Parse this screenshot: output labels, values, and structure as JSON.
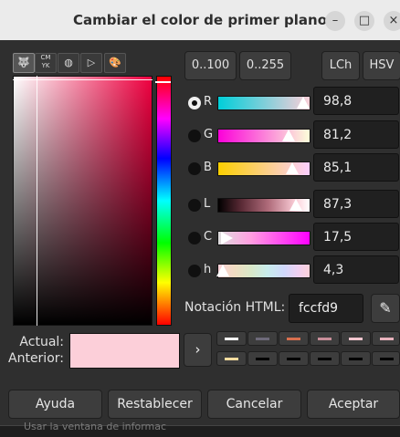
{
  "window": {
    "title": "Cambiar el color de primer plano"
  },
  "window_controls": {
    "minimize": "–",
    "maximize": "□",
    "close": "×"
  },
  "notebook_tabs": [
    {
      "icon": "gimp-wilber-icon",
      "glyph": "🐺",
      "active": true
    },
    {
      "icon": "cmyk-icon",
      "glyph": "CMYK",
      "active": false
    },
    {
      "icon": "water-color-icon",
      "glyph": "◍",
      "active": false
    },
    {
      "icon": "color-wheel-icon",
      "glyph": "▷",
      "active": false
    },
    {
      "icon": "palette-icon",
      "glyph": "🎨",
      "active": false
    }
  ],
  "range_buttons": {
    "r0100": "0..100",
    "r0255": "0..255"
  },
  "model_buttons": {
    "lch": "LCh",
    "hsv": "HSV"
  },
  "channels": [
    {
      "label": "R",
      "value": "98,8",
      "selected": true
    },
    {
      "label": "G",
      "value": "81,2",
      "selected": false
    },
    {
      "label": "B",
      "value": "85,1",
      "selected": false
    },
    {
      "label": "L",
      "value": "87,3",
      "selected": false
    },
    {
      "label": "C",
      "value": "17,5",
      "selected": false
    },
    {
      "label": "h",
      "value": "4,3",
      "selected": false
    }
  ],
  "html_notation": {
    "label": "Notación HTML:",
    "value": "fccfd9"
  },
  "current": {
    "actual_label": "Actual:",
    "previous_label": "Anterior:",
    "color": "#fccfd9"
  },
  "history_colors": [
    "#ffffff",
    "#6e6a7a",
    "#d9704f",
    "#c98f9a",
    "#f2c6cf",
    "#e8b2bd",
    "#f7dc9e",
    "#000000",
    "#000000",
    "#000000",
    "#000000",
    "#000000"
  ],
  "buttons": {
    "help": "Ayuda",
    "reset": "Restablecer",
    "cancel": "Cancelar",
    "accept": "Aceptar"
  },
  "background_text": "Usar la ventana de informac"
}
